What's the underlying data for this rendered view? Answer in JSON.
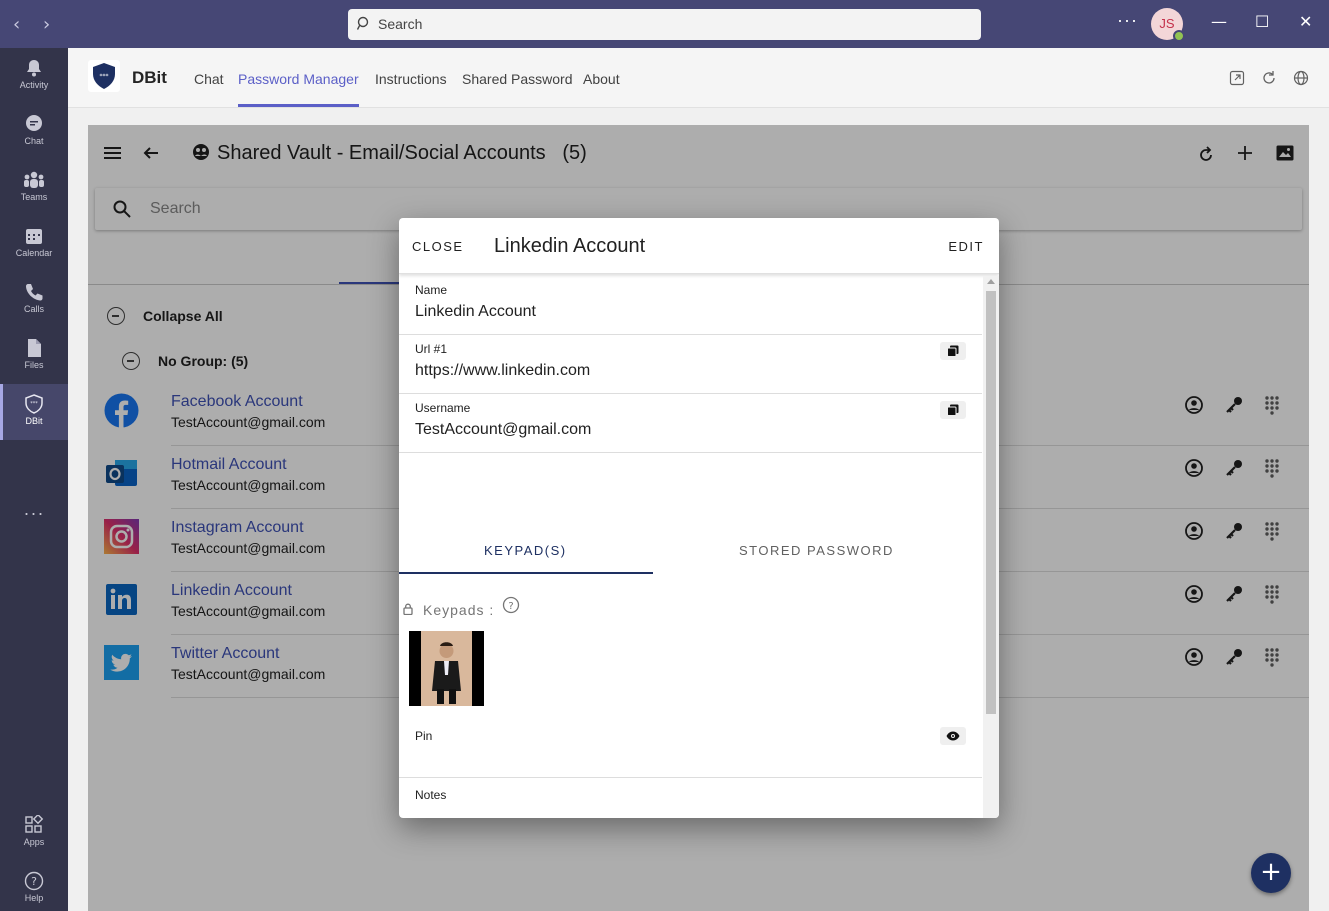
{
  "titlebar": {
    "search_placeholder": "Search",
    "avatar_initials": "JS"
  },
  "rail": {
    "items": [
      {
        "label": "Activity",
        "icon": "bell-icon"
      },
      {
        "label": "Chat",
        "icon": "chat-icon"
      },
      {
        "label": "Teams",
        "icon": "teams-icon"
      },
      {
        "label": "Calendar",
        "icon": "calendar-icon"
      },
      {
        "label": "Calls",
        "icon": "phone-icon"
      },
      {
        "label": "Files",
        "icon": "file-icon"
      },
      {
        "label": "DBit",
        "icon": "shield-icon"
      }
    ],
    "bottom": [
      {
        "label": "Apps",
        "icon": "apps-icon"
      },
      {
        "label": "Help",
        "icon": "help-icon"
      }
    ]
  },
  "appheader": {
    "app_name": "DBit",
    "tabs": [
      "Chat",
      "Password Manager",
      "Instructions",
      "Shared Password",
      "About"
    ],
    "active_tab": "Password Manager"
  },
  "vault": {
    "title": "Shared Vault - Email/Social Accounts",
    "count": "(5)",
    "search_placeholder": "Search",
    "collapse_all": "Collapse All",
    "group_label": "No Group: (5)",
    "accounts": [
      {
        "name": "Facebook Account",
        "email": "TestAccount@gmail.com"
      },
      {
        "name": "Hotmail Account",
        "email": "TestAccount@gmail.com"
      },
      {
        "name": "Instagram Account",
        "email": "TestAccount@gmail.com"
      },
      {
        "name": "Linkedin Account",
        "email": "TestAccount@gmail.com"
      },
      {
        "name": "Twitter Account",
        "email": "TestAccount@gmail.com"
      }
    ]
  },
  "modal": {
    "close_label": "CLOSE",
    "title": "Linkedin Account",
    "edit_label": "EDIT",
    "fields": {
      "name_label": "Name",
      "name_value": "Linkedin Account",
      "url_label": "Url #1",
      "url_value": "https://www.linkedin.com",
      "username_label": "Username",
      "username_value": "TestAccount@gmail.com"
    },
    "tabs": [
      "KEYPAD(S)",
      "STORED PASSWORD"
    ],
    "keypads_label": "Keypads :",
    "pin_label": "Pin",
    "notes_label": "Notes"
  },
  "colors": {
    "titlebar": "#464775",
    "rail": "#33344a",
    "accent": "#5b5fc7",
    "link": "#3f51b5",
    "fab": "#1e3062"
  }
}
